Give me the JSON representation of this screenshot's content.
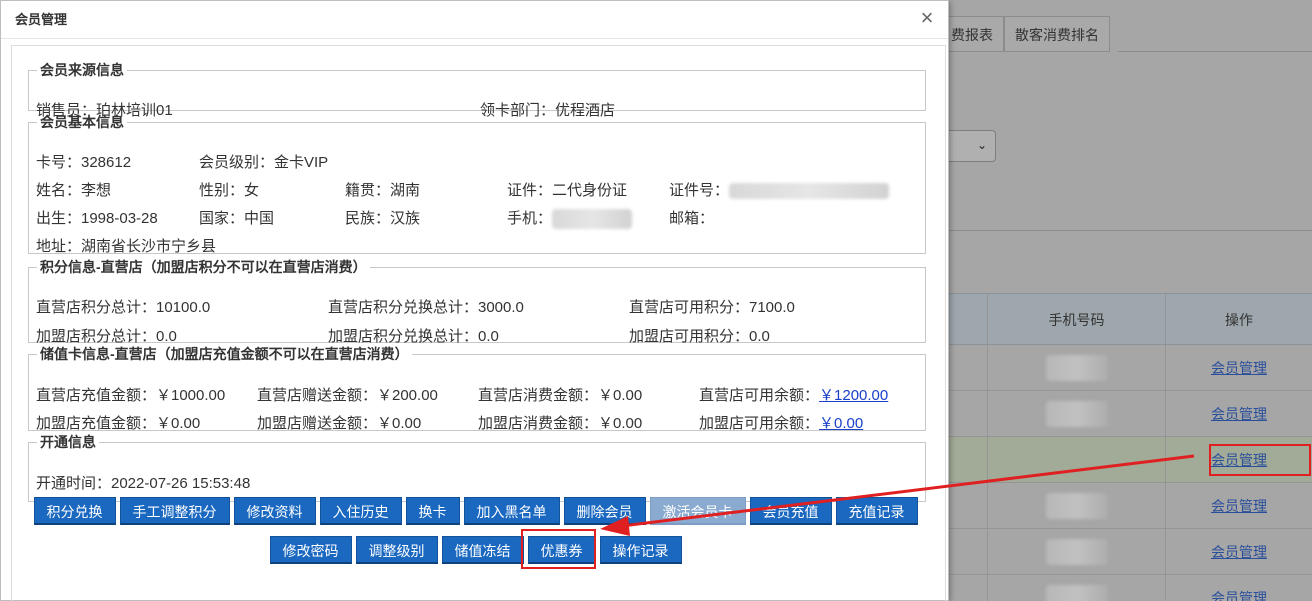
{
  "background": {
    "tabs": [
      "费报表",
      "散客消费排名"
    ],
    "table": {
      "headers": [
        "手机号码",
        "操作"
      ],
      "rows": [
        {
          "link": "会员管理"
        },
        {
          "link": "会员管理"
        },
        {
          "link": "会员管理"
        },
        {
          "link": "会员管理"
        },
        {
          "link": "会员管理"
        },
        {
          "link": "会员管理"
        }
      ]
    }
  },
  "modal": {
    "title": "会员管理",
    "close_icon": "×",
    "source": {
      "legend": "会员来源信息",
      "salesperson": "销售员：珀林培训01",
      "department": "领卡部门：优程酒店"
    },
    "basic": {
      "legend": "会员基本信息",
      "card_no": "卡号：328612",
      "level": "会员级别：金卡VIP",
      "name": "姓名：李想",
      "gender": "性别：女",
      "native": "籍贯：湖南",
      "id_type": "证件：二代身份证",
      "id_no_label": "证件号：",
      "birth": "出生：1998-03-28",
      "country": "国家：中国",
      "ethnic": "民族：汉族",
      "phone_label": "手机：",
      "email_label": "邮箱：",
      "address": "地址：湖南省长沙市宁乡县"
    },
    "points": {
      "legend": "积分信息-直营店（加盟店积分不可以在直营店消费）",
      "direct_total": "直营店积分总计：10100.0",
      "direct_exchange": "直营店积分兑换总计：3000.0",
      "direct_available": "直营店可用积分：7100.0",
      "franchise_total": "加盟店积分总计：0.0",
      "franchise_exchange": "加盟店积分兑换总计：0.0",
      "franchise_available": "加盟店可用积分：0.0"
    },
    "stored": {
      "legend": "储值卡信息-直营店（加盟店充值金额不可以在直营店消费）",
      "direct_recharge": "直营店充值金额：￥1000.00",
      "direct_gift": "直营店赠送金额：￥200.00",
      "direct_consume": "直营店消费金额：￥0.00",
      "direct_balance_label": "直营店可用余额：",
      "direct_balance": "￥1200.00",
      "franchise_recharge": "加盟店充值金额：￥0.00",
      "franchise_gift": "加盟店赠送金额：￥0.00",
      "franchise_consume": "加盟店消费金额：￥0.00",
      "franchise_balance_label": "加盟店可用余额：",
      "franchise_balance": "￥0.00"
    },
    "open": {
      "legend": "开通信息",
      "time": "开通时间：2022-07-26 15:53:48"
    },
    "buttons_row1": [
      "积分兑换",
      "手工调整积分",
      "修改资料",
      "入住历史",
      "换卡",
      "加入黑名单",
      "删除会员",
      "激活会员卡",
      "会员充值",
      "充值记录"
    ],
    "buttons_row2": [
      "修改密码",
      "调整级别",
      "储值冻结",
      "优惠券",
      "操作记录"
    ]
  }
}
